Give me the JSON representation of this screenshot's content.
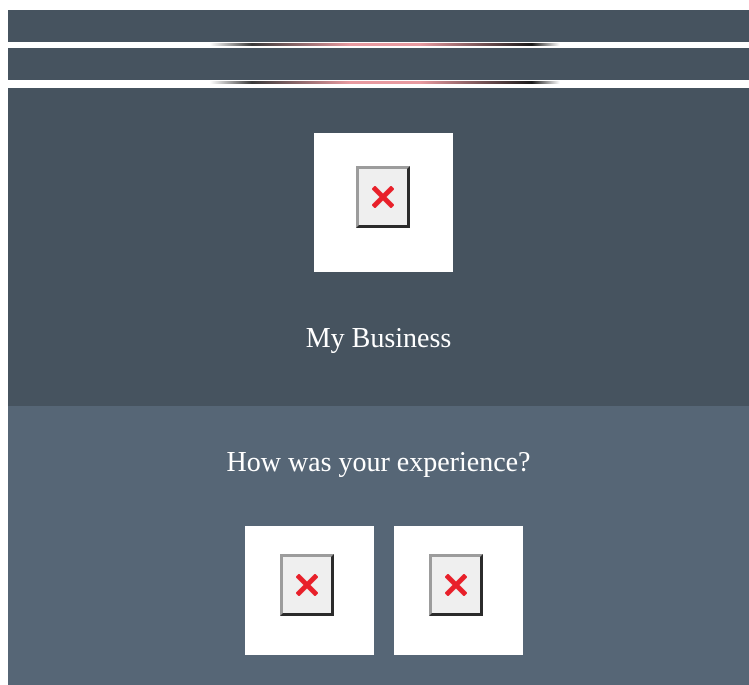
{
  "header": {
    "business_name": "My Business",
    "logo_icon": "broken-image-icon"
  },
  "feedback": {
    "question": "How was your experience?",
    "options": [
      {
        "icon": "broken-image-icon"
      },
      {
        "icon": "broken-image-icon"
      }
    ]
  },
  "colors": {
    "header_bg": "#46535f",
    "feedback_bg": "#566676",
    "tile_bg": "#ffffff",
    "broken_icon_x": "#e8202a",
    "text": "#ffffff"
  }
}
